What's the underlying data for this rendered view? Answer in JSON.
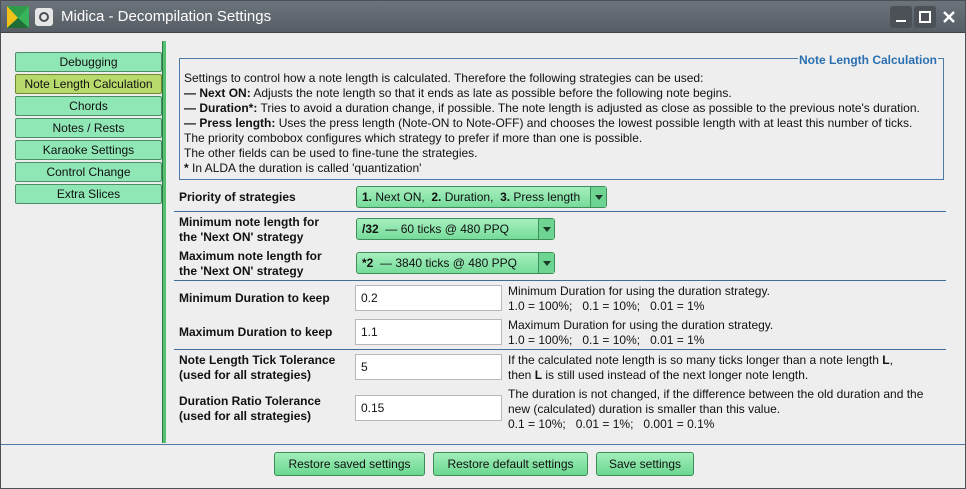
{
  "window": {
    "title": "Midica - Decompilation Settings"
  },
  "sidebar": {
    "tabs": [
      {
        "label": "Debugging",
        "active": false
      },
      {
        "label": "Note Length Calculation",
        "active": true
      },
      {
        "label": "Chords",
        "active": false
      },
      {
        "label": "Notes / Rests",
        "active": false
      },
      {
        "label": "Karaoke Settings",
        "active": false
      },
      {
        "label": "Control Change",
        "active": false
      },
      {
        "label": "Extra Slices",
        "active": false
      }
    ]
  },
  "group": {
    "title": "Note Length Calculation",
    "intro": "Settings to control how a note length is calculated. Therefore the following strategies can be used:",
    "items": [
      {
        "prefix": "— ",
        "term": "Next ON:",
        "text": " Adjusts the note length so that it ends as late as possible before the following note begins."
      },
      {
        "prefix": "— ",
        "term": "Duration*:",
        "text": " Tries to avoid a duration change, if possible. The note length is adjusted as close as possible to the previous note's duration."
      },
      {
        "prefix": "— ",
        "term": "Press length:",
        "text": " Uses the press length (Note-ON to Note-OFF) and chooses the lowest possible length with at least this number of ticks."
      }
    ],
    "line_priority": "The priority combobox configures which strategy to prefer if more than one is possible.",
    "line_other": "The other fields can be used to fine-tune the strategies.",
    "footnote_mark": "*",
    "footnote_text": " In ALDA the duration is called 'quantization'"
  },
  "priority": {
    "label": "Priority of strategies",
    "parts": [
      {
        "num": "1.",
        "name": " Next ON,  "
      },
      {
        "num": "2.",
        "name": " Duration,  "
      },
      {
        "num": "3.",
        "name": " Press length"
      }
    ]
  },
  "min_length": {
    "label_line1": "Minimum note length for",
    "label_line2": "the 'Next ON' strategy",
    "value_bold": "/32",
    "value_rest": "  — 60 ticks @ 480 PPQ"
  },
  "max_length": {
    "label_line1": "Maximum note length for",
    "label_line2": "the 'Next ON' strategy",
    "value_bold": "*2",
    "value_rest": "  — 3840 ticks @ 480 PPQ"
  },
  "min_duration": {
    "label": "Minimum Duration to keep",
    "value": "0.2",
    "help1": "Minimum Duration for using the duration strategy.",
    "help2": "1.0 = 100%;   0.1 = 10%;   0.01 = 1%"
  },
  "max_duration": {
    "label": "Maximum Duration to keep",
    "value": "1.1",
    "help1": "Maximum Duration for using the duration strategy.",
    "help2": "1.0 = 100%;   0.1 = 10%;   0.01 = 1%"
  },
  "tick_tolerance": {
    "label_line1": "Note Length Tick Tolerance",
    "label_line2": "(used for all strategies)",
    "value": "5",
    "help1_a": "If the calculated note length is so many ticks longer than a note length ",
    "help1_b": "L",
    "help1_c": ",",
    "help2_a": "then ",
    "help2_b": "L",
    "help2_c": " is still used instead of the next longer note length."
  },
  "ratio_tolerance": {
    "label_line1": "Duration Ratio Tolerance",
    "label_line2": "(used for all strategies)",
    "value": "0.15",
    "help1": "The duration is not changed, if the difference between the old duration and the",
    "help2": "new (calculated) duration is smaller than this value.",
    "help3": "0.1 = 10%;   0.01 = 1%;   0.001 = 0.1%"
  },
  "buttons": {
    "restore_saved": "Restore saved settings",
    "restore_default": "Restore default settings",
    "save": "Save settings"
  },
  "colors": {
    "accent_green": "#8fe7b5",
    "active_tab": "#b8d96b",
    "group_title": "#2a6fb0",
    "titlebar": "#5f666d"
  }
}
